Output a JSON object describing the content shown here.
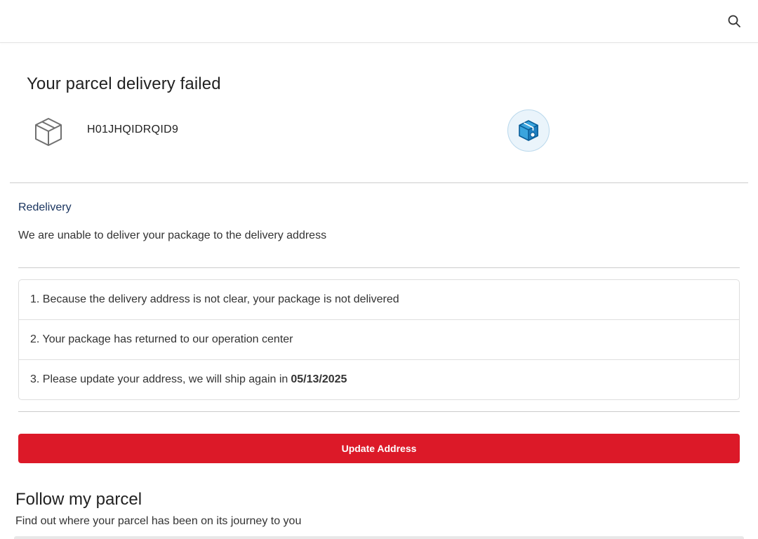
{
  "header": {
    "search_icon": "search-icon"
  },
  "parcel": {
    "title": "Your parcel delivery failed",
    "tracking_number": "H01JHQIDRQID9",
    "box_icon": "package-box-icon",
    "status_icon": "package-status-icon"
  },
  "redelivery": {
    "label": "Redelivery",
    "message": "We are unable to deliver your package to the delivery address",
    "steps": [
      {
        "text": "1. Because the delivery address is not clear, your package is not delivered"
      },
      {
        "text": "2. Your package has returned to our operation center"
      },
      {
        "text": "3. Please update your address, we will ship again in",
        "date": "05/13/2025"
      }
    ],
    "button_label": "Update Address",
    "button_color": "#dc1928",
    "label_color": "#18335e"
  },
  "follow": {
    "title": "Follow my parcel",
    "subtitle": "Find out where your parcel has been on its journey to you"
  }
}
